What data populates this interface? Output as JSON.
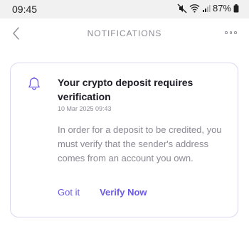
{
  "status_bar": {
    "time": "09:45",
    "battery": "87%"
  },
  "header": {
    "title": "NOTIFICATIONS"
  },
  "notification": {
    "title": "Your crypto deposit requires verification",
    "date": "10 Mar 2025 09:43",
    "body": "In order for a deposit to be credited, you must verify that the sender's address comes from an account you own.",
    "actions": {
      "dismiss_label": "Got it",
      "verify_label": "Verify Now"
    }
  },
  "colors": {
    "accent": "#6a5ae6",
    "card_border": "#dcd8f0",
    "muted_text": "#8a8a95"
  },
  "icons": [
    "back-arrow-icon",
    "more-options-icon",
    "bell-icon",
    "mute-icon",
    "wifi-icon",
    "signal-icon",
    "battery-icon"
  ]
}
